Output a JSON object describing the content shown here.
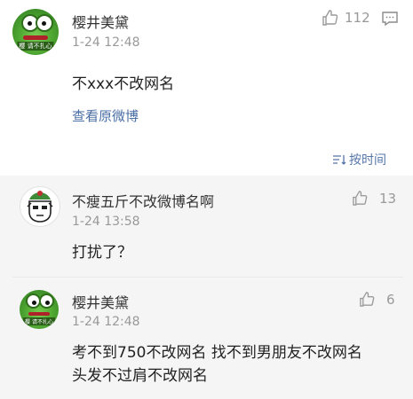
{
  "post": {
    "author": "樱井美黛",
    "time": "1-24 12:48",
    "like_count": "112",
    "text": "不xxx不改网名",
    "view_original": "查看原微博",
    "avatar_tag": "樱 请不扎心"
  },
  "sort": {
    "label": "按时间"
  },
  "comments": [
    {
      "author": "不瘦五斤不改微博名啊",
      "time": "1-24 13:58",
      "text": "打扰了？",
      "likes": "13"
    },
    {
      "author": "樱井美黛",
      "time": "1-24 12:48",
      "text_line1": "考不到750不改网名 找不到男朋友不改网名",
      "text_line2": "头发不过肩不改网名",
      "likes": "6",
      "avatar_tag": "樱 请不扎心"
    }
  ],
  "colors": {
    "link": "#4a6ea5",
    "muted": "#999999",
    "comments_bg": "#f5f5f5"
  }
}
